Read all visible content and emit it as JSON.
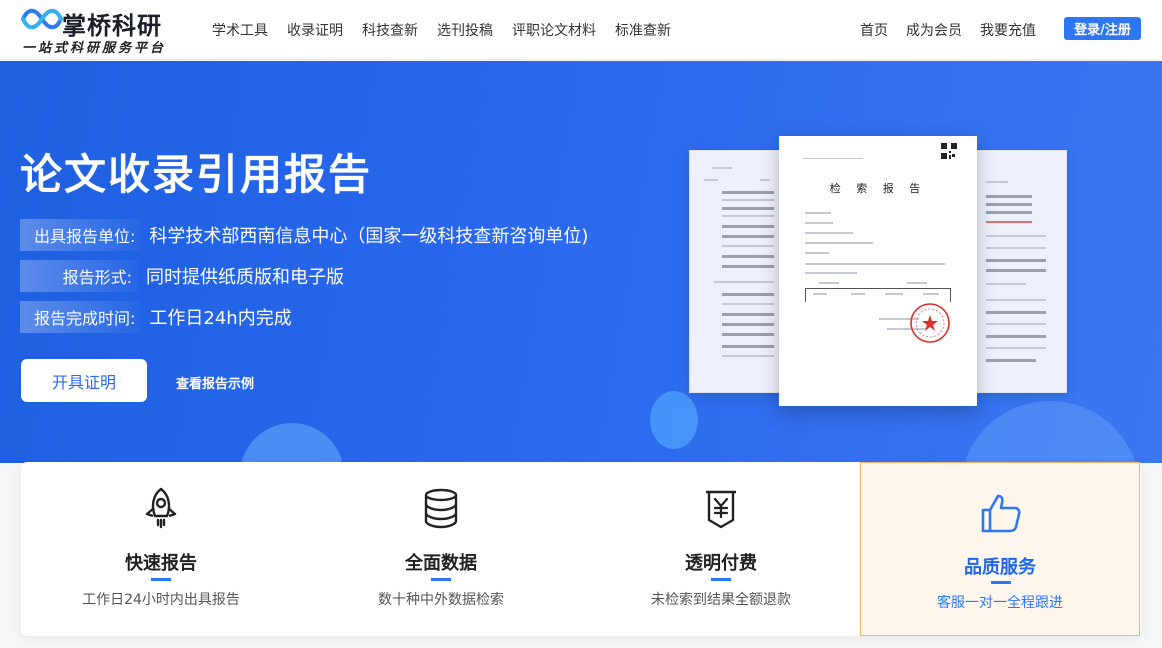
{
  "header": {
    "logo_name": "掌桥科研",
    "logo_slogan": "一站式科研服务平台",
    "nav": [
      "学术工具",
      "收录证明",
      "科技查新",
      "选刊投稿",
      "评职论文材料",
      "标准查新"
    ],
    "nav_right": [
      "首页",
      "成为会员",
      "我要充值"
    ],
    "login_label": "登录/注册",
    "accent_color": "#2f76f5"
  },
  "hero": {
    "title": "论文收录引用报告",
    "info": [
      {
        "label": "出具报告单位:",
        "value": "科学技术部西南信息中心（国家一级科技查新咨询单位)"
      },
      {
        "label": "报告形式:",
        "value": "同时提供纸质版和电子版"
      },
      {
        "label": "报告完成时间:",
        "value": "工作日24h内完成"
      }
    ],
    "cta_label": "开具证明",
    "example_label": "查看报告示例",
    "doc_title": "检 索 报 告"
  },
  "features": [
    {
      "icon": "rocket-icon",
      "title": "快速报告",
      "desc": "工作日24小时内出具报告",
      "active": false
    },
    {
      "icon": "database-icon",
      "title": "全面数据",
      "desc": "数十种中外数据检索",
      "active": false
    },
    {
      "icon": "yuan-receipt-icon",
      "title": "透明付费",
      "desc": "未检索到结果全额退款",
      "active": false
    },
    {
      "icon": "thumbs-up-icon",
      "title": "品质服务",
      "desc": "客服一对一全程跟进",
      "active": true
    }
  ]
}
